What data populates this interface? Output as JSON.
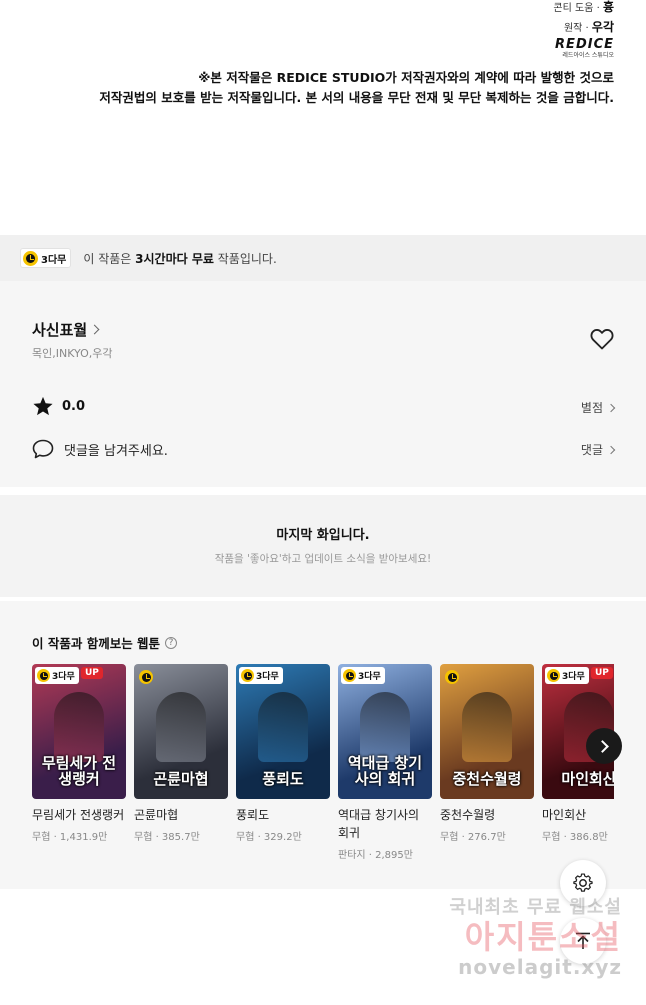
{
  "credits": {
    "assist_label": "콘티 도움",
    "assist_value": "흉",
    "original_label": "원작",
    "original_value": "우각",
    "logo_mark": "REDICE",
    "logo_sub": "레드아이스 스튜디오"
  },
  "notice": {
    "line1": "※본 저작물은 REDICE STUDIO가 저작권자와의 계약에 따라 발행한 것으로",
    "line2": "저작권법의 보호를 받는 저작물입니다. 본 서의 내용을 무단 전재 및 무단 복제하는 것을 금합니다."
  },
  "free": {
    "badge": "3다무",
    "text_pre": "이 작품은 ",
    "text_bold": "3시간마다 무료",
    "text_post": " 작품입니다."
  },
  "work": {
    "title": "사신표월",
    "authors": "목인,INKYO,우각",
    "rating": "0.0",
    "rating_link": "별점",
    "comment_prompt": "댓글을 남겨주세요.",
    "comment_link": "댓글"
  },
  "last_episode": {
    "title": "마지막 화입니다.",
    "subtitle": "작품을 '좋아요'하고 업데이트 소식을 받아보세요!"
  },
  "recommendations": {
    "title": "이 작품과 함께보는 웹툰",
    "help": "?",
    "items": [
      {
        "name": "무림세가 전생랭커",
        "meta": "무협 · 1,431.9만",
        "badge": "3다무",
        "up": "UP",
        "thumb_text": "무림세가 전생랭커",
        "bg1": "#3a1e4a",
        "bg2": "#b23a55"
      },
      {
        "name": "곤륜마협",
        "meta": "무협 · 385.7만",
        "badge": "",
        "up": "",
        "thumb_text": "곤륜마협",
        "bg1": "#2c2f3a",
        "bg2": "#8a8f9a"
      },
      {
        "name": "풍뢰도",
        "meta": "무협 · 329.2만",
        "badge": "3다무",
        "up": "",
        "thumb_text": "풍뢰도",
        "bg1": "#0f2a4a",
        "bg2": "#2e7bb5"
      },
      {
        "name": "역대급 창기사의 회귀",
        "meta": "판타지 · 2,895만",
        "badge": "3다무",
        "up": "",
        "thumb_text": "역대급 창기사의 회귀",
        "bg1": "#1e3a6a",
        "bg2": "#8fb0e0"
      },
      {
        "name": "중천수월령",
        "meta": "무협 · 276.7만",
        "badge": "",
        "up": "",
        "thumb_text": "중천수월령",
        "bg1": "#6a3a20",
        "bg2": "#e0a040"
      },
      {
        "name": "마인회산",
        "meta": "무협 · 386.8만",
        "badge": "3다무",
        "up": "UP",
        "thumb_text": "마인회산",
        "bg1": "#3a0a10",
        "bg2": "#c03040"
      }
    ]
  },
  "watermark": {
    "line1": "국내최초 무료 웹소설",
    "line2": "아지툰소설",
    "line3": "novelagit.xyz"
  }
}
